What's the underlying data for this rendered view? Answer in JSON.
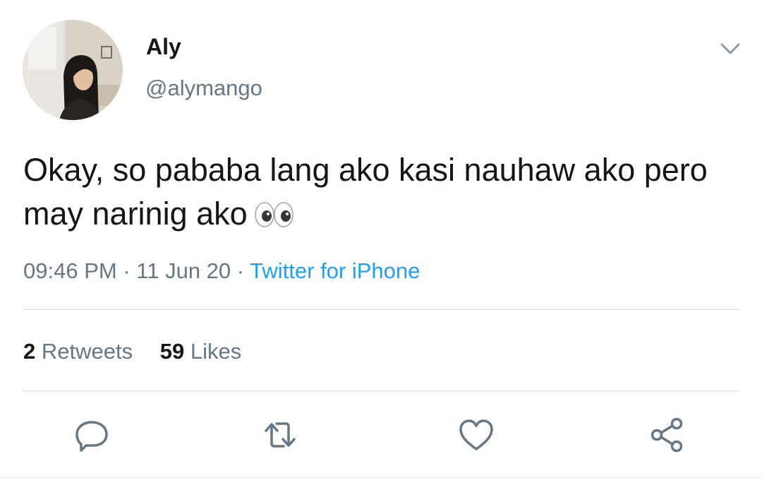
{
  "user": {
    "display_name": "Aly",
    "handle": "@alymango"
  },
  "tweet": {
    "text": "Okay, so pababa lang ako kasi nauhaw ako pero may narinig ako",
    "emoji": "eyes-emoji"
  },
  "meta": {
    "time": "09:46 PM",
    "date": "11 Jun 20",
    "separator": "·",
    "source": "Twitter for iPhone"
  },
  "stats": {
    "retweets_count": "2",
    "retweets_label": "Retweets",
    "likes_count": "59",
    "likes_label": "Likes"
  },
  "icons": {
    "menu": "chevron-down-icon",
    "reply": "reply-icon",
    "retweet": "retweet-icon",
    "like": "heart-icon",
    "share": "share-icon"
  },
  "colors": {
    "text_primary": "#14171a",
    "text_secondary": "#657786",
    "link": "#1da1f2",
    "divider": "#ccd6dd"
  }
}
